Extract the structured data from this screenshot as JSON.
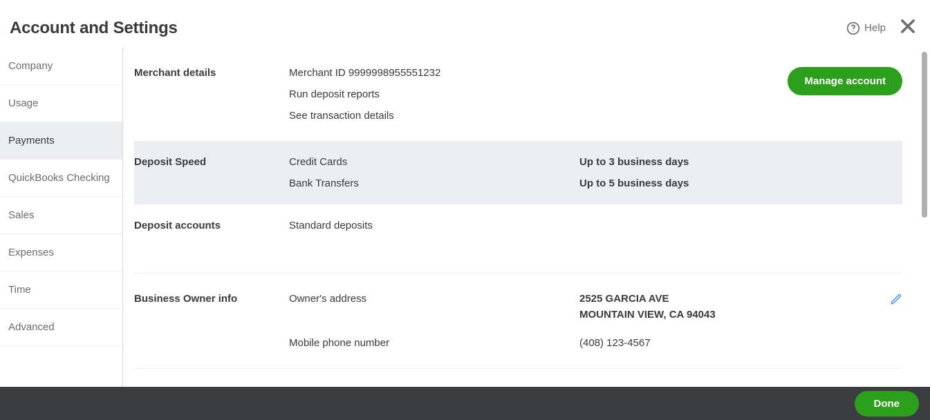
{
  "header": {
    "title": "Account and Settings",
    "help": "Help"
  },
  "sidebar": {
    "items": [
      {
        "label": "Company"
      },
      {
        "label": "Usage"
      },
      {
        "label": "Payments"
      },
      {
        "label": "QuickBooks Checking"
      },
      {
        "label": "Sales"
      },
      {
        "label": "Expenses"
      },
      {
        "label": "Time"
      },
      {
        "label": "Advanced"
      }
    ],
    "active_index": 2
  },
  "sections": {
    "merchant": {
      "title": "Merchant details",
      "id_line": "Merchant ID 9999998955551232",
      "link1": "Run deposit reports",
      "link2": "See transaction details",
      "manage_btn": "Manage account"
    },
    "speed": {
      "title": "Deposit Speed",
      "rows": [
        {
          "k": "Credit Cards",
          "v": "Up to 3 business days"
        },
        {
          "k": "Bank Transfers",
          "v": "Up to 5 business days"
        }
      ]
    },
    "accounts": {
      "title": "Deposit accounts",
      "value": "Standard deposits"
    },
    "owner": {
      "title": "Business Owner info",
      "address_label": "Owner's address",
      "address_line1": "2525 GARCIA AVE",
      "address_line2": "MOUNTAIN VIEW, CA 94043",
      "phone_label": "Mobile phone number",
      "phone_value": "(408) 123-4567"
    }
  },
  "footer": {
    "done": "Done"
  }
}
